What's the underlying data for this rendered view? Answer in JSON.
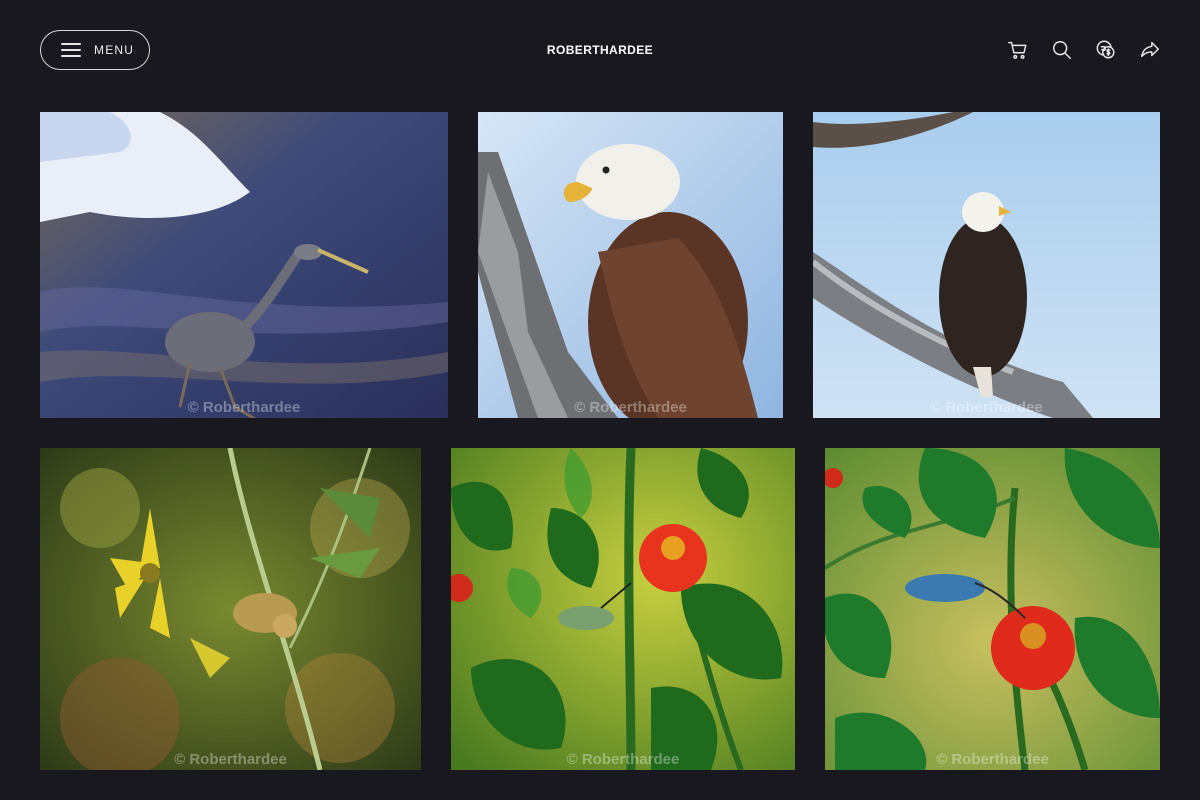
{
  "header": {
    "menu_label": "MENU",
    "brand": "ROBERTHARDEE",
    "icons": [
      "cart-icon",
      "search-icon",
      "currency-icon",
      "share-icon"
    ]
  },
  "gallery": [
    {
      "subject": "heron",
      "watermark": "© Roberthardee"
    },
    {
      "subject": "eagle-closeup",
      "watermark": "© Roberthardee"
    },
    {
      "subject": "eagle-branch",
      "watermark": "© Roberthardee"
    },
    {
      "subject": "bird-yellow-flower",
      "watermark": "© Roberthardee"
    },
    {
      "subject": "hummingbird-red-flower",
      "watermark": "© Roberthardee"
    },
    {
      "subject": "hummingbird-red-flower-2",
      "watermark": "© Roberthardee"
    }
  ],
  "colors": {
    "background": "#1a181f",
    "accent": "#ffffff"
  }
}
